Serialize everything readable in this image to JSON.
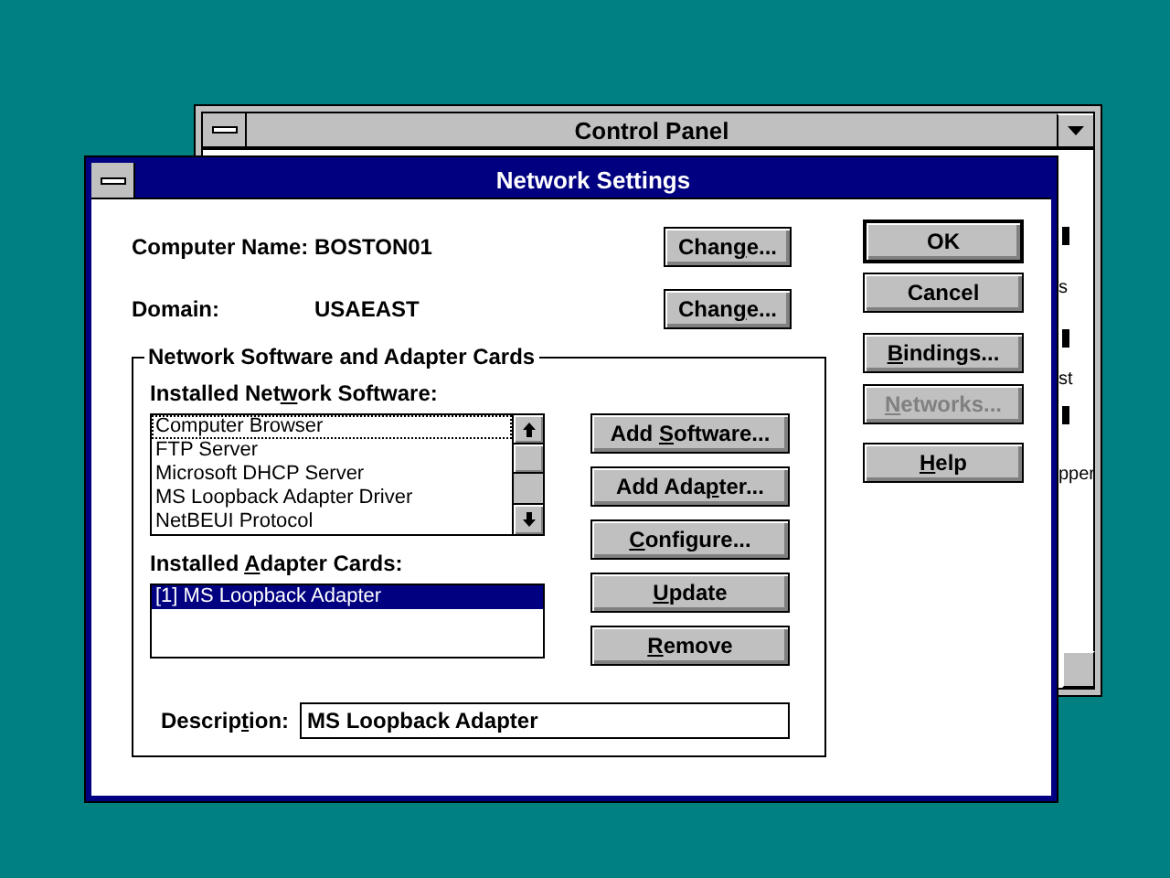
{
  "background_window": {
    "title": "Control Panel",
    "icon_labels": [
      "s",
      "st",
      "pper"
    ]
  },
  "dialog": {
    "title": "Network Settings",
    "fields": [
      {
        "label": "Computer Name:",
        "value": "BOSTON01",
        "button": {
          "pre": "Chan",
          "key": "g",
          "post": "e..."
        }
      },
      {
        "label": "Domain:",
        "value": "USAEAST",
        "button": {
          "pre": "Chan",
          "key": "g",
          "post": "e..."
        }
      }
    ],
    "group": {
      "title": "Network Software and Adapter Cards",
      "software_label": {
        "pre": "Installed Net",
        "key": "w",
        "post": "ork Software:"
      },
      "software_items": [
        {
          "label": "Computer Browser",
          "focused": true
        },
        {
          "label": "FTP Server",
          "focused": false
        },
        {
          "label": "Microsoft DHCP Server",
          "focused": false
        },
        {
          "label": "MS Loopback Adapter Driver",
          "focused": false
        },
        {
          "label": "NetBEUI Protocol",
          "focused": false
        }
      ],
      "adapter_label": {
        "pre": "Installed ",
        "key": "A",
        "post": "dapter Cards:"
      },
      "adapter_items": [
        {
          "label": "[1] MS Loopback Adapter",
          "selected": true
        }
      ],
      "buttons": [
        {
          "pre": "Add ",
          "key": "S",
          "post": "oftware..."
        },
        {
          "pre": "Add Ada",
          "key": "p",
          "post": "ter..."
        },
        {
          "key": "C",
          "post": "onfigure..."
        },
        {
          "key": "U",
          "post": "pdate"
        },
        {
          "key": "R",
          "post": "emove"
        }
      ],
      "description_label": {
        "pre": "Descrip",
        "key": "t",
        "post": "ion:"
      },
      "description": "MS Loopback Adapter"
    },
    "side_buttons": [
      {
        "post": "OK",
        "default": true,
        "disabled": false
      },
      {
        "post": "Cancel",
        "default": false,
        "disabled": false
      },
      {
        "key": "B",
        "post": "indings...",
        "default": false,
        "disabled": false
      },
      {
        "key": "N",
        "post": "etworks...",
        "default": false,
        "disabled": true
      },
      {
        "key": "H",
        "post": "elp",
        "default": false,
        "disabled": false
      }
    ]
  }
}
